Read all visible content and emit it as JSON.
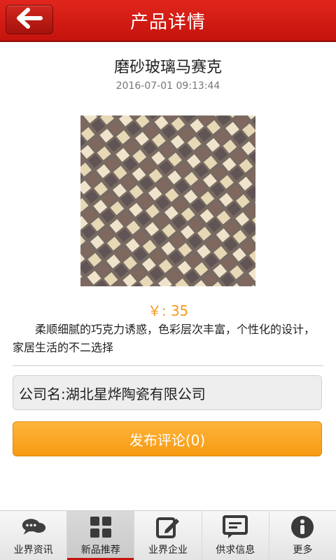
{
  "header": {
    "title": "产品详情",
    "back_icon": "arrow-left-icon",
    "accent_color": "#c4130d"
  },
  "product": {
    "title": "磨砂玻璃马赛克",
    "datetime": "2016-07-01 09:13:44",
    "price": "￥: 35",
    "description": "柔顺细腻的巧克力诱惑，色彩层次丰富，个性化的设计，家居生活的不二选择",
    "company": "公司名:湖北星烨陶瓷有限公司",
    "comment_button": "发布评论(0)",
    "price_color": "#f39a1d"
  },
  "tabbar": {
    "items": [
      {
        "label": "业界资讯",
        "icon": "chat-bubbles-icon"
      },
      {
        "label": "新品推荐",
        "icon": "grid-icon"
      },
      {
        "label": "业界企业",
        "icon": "edit-icon"
      },
      {
        "label": "供求信息",
        "icon": "message-box-icon"
      },
      {
        "label": "更多",
        "icon": "info-icon"
      }
    ],
    "active_index": 1
  }
}
